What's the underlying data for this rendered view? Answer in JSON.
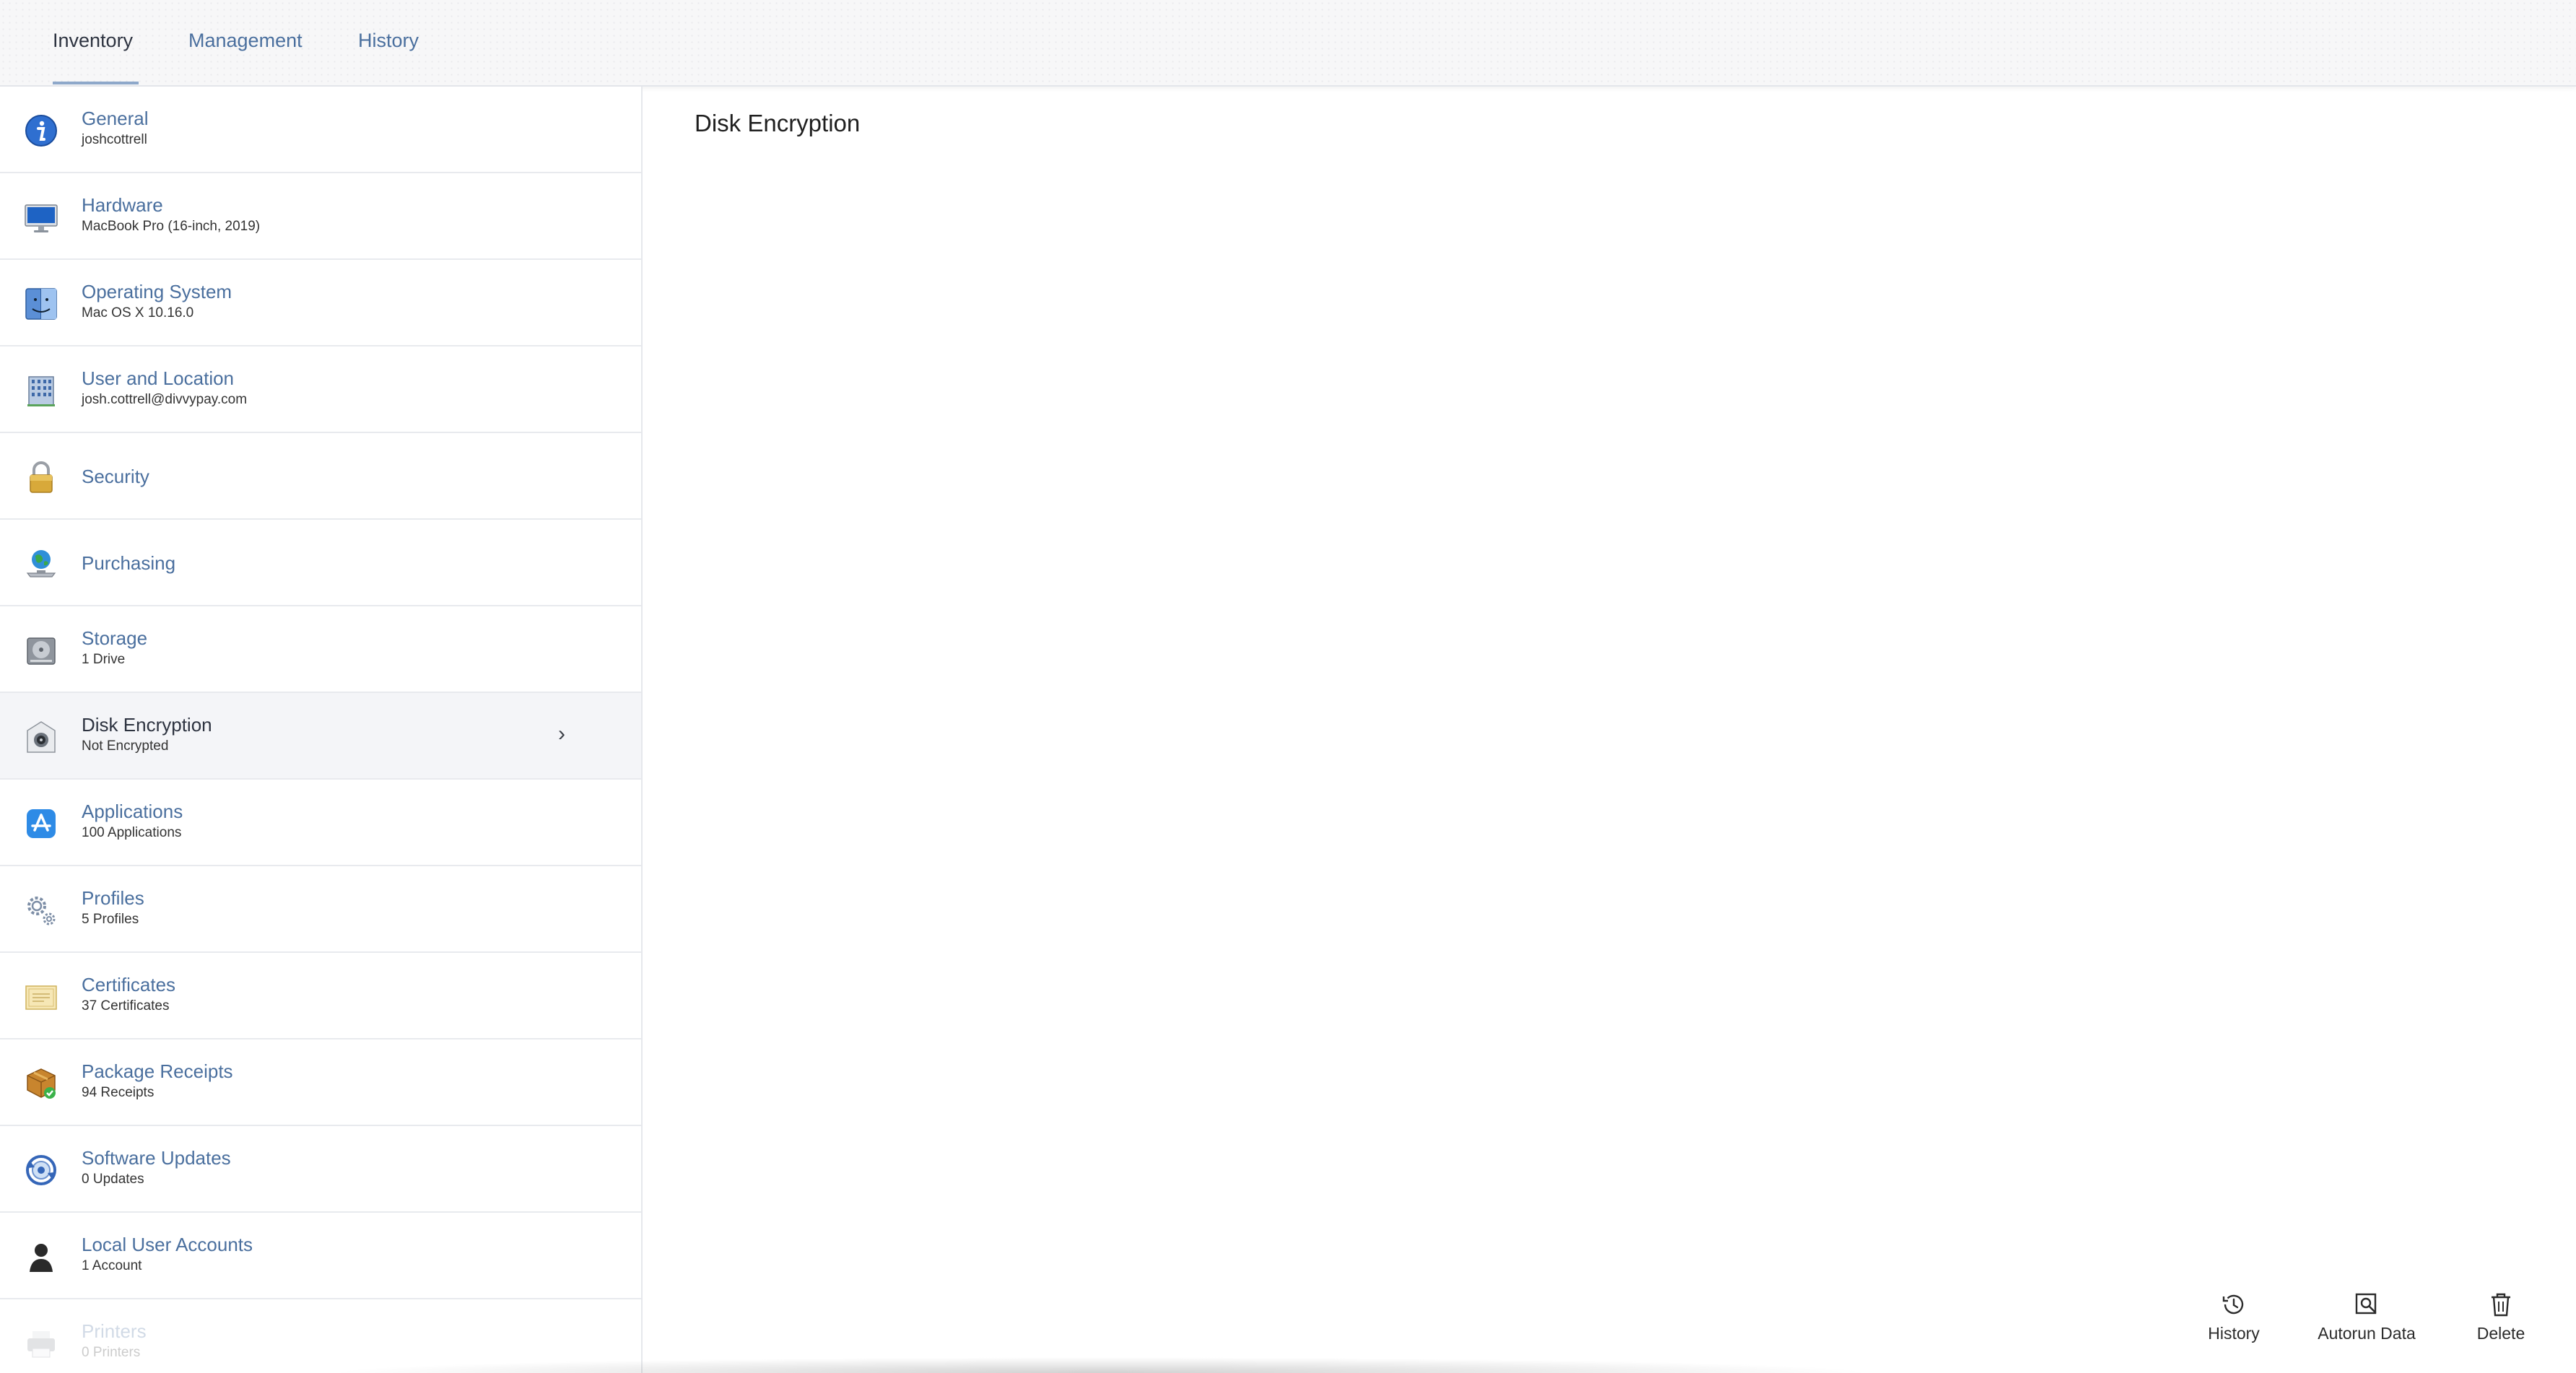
{
  "tabs": [
    {
      "label": "Inventory",
      "active": true
    },
    {
      "label": "Management",
      "active": false
    },
    {
      "label": "History",
      "active": false
    }
  ],
  "sidebar": {
    "items": [
      {
        "title": "General",
        "subtitle": "joshcottrell",
        "icon": "info-icon"
      },
      {
        "title": "Hardware",
        "subtitle": "MacBook Pro (16-inch, 2019)",
        "icon": "monitor-icon"
      },
      {
        "title": "Operating System",
        "subtitle": "Mac OS X 10.16.0",
        "icon": "finder-icon"
      },
      {
        "title": "User and Location",
        "subtitle": "josh.cottrell@divvypay.com",
        "icon": "building-icon"
      },
      {
        "title": "Security",
        "subtitle": "",
        "icon": "padlock-icon"
      },
      {
        "title": "Purchasing",
        "subtitle": "",
        "icon": "globe-icon"
      },
      {
        "title": "Storage",
        "subtitle": "1 Drive",
        "icon": "hard-drive-icon"
      },
      {
        "title": "Disk Encryption",
        "subtitle": "Not Encrypted",
        "icon": "filevault-icon",
        "active": true
      },
      {
        "title": "Applications",
        "subtitle": "100 Applications",
        "icon": "app-store-icon"
      },
      {
        "title": "Profiles",
        "subtitle": "5 Profiles",
        "icon": "gears-icon"
      },
      {
        "title": "Certificates",
        "subtitle": "37 Certificates",
        "icon": "certificate-icon"
      },
      {
        "title": "Package Receipts",
        "subtitle": "94 Receipts",
        "icon": "package-icon"
      },
      {
        "title": "Software Updates",
        "subtitle": "0 Updates",
        "icon": "software-update-icon"
      },
      {
        "title": "Local User Accounts",
        "subtitle": "1 Account",
        "icon": "user-silhouette-icon"
      },
      {
        "title": "Printers",
        "subtitle": "0 Printers",
        "icon": "printer-icon"
      }
    ]
  },
  "main": {
    "title": "Disk Encryption"
  },
  "actions": [
    {
      "label": "History",
      "icon": "clock-history-icon"
    },
    {
      "label": "Autorun Data",
      "icon": "search-document-icon"
    },
    {
      "label": "Delete",
      "icon": "trash-icon"
    }
  ],
  "colors": {
    "link": "#4a6f9e",
    "active_bg": "#f4f5f8",
    "underline": "#8ea8ca"
  }
}
